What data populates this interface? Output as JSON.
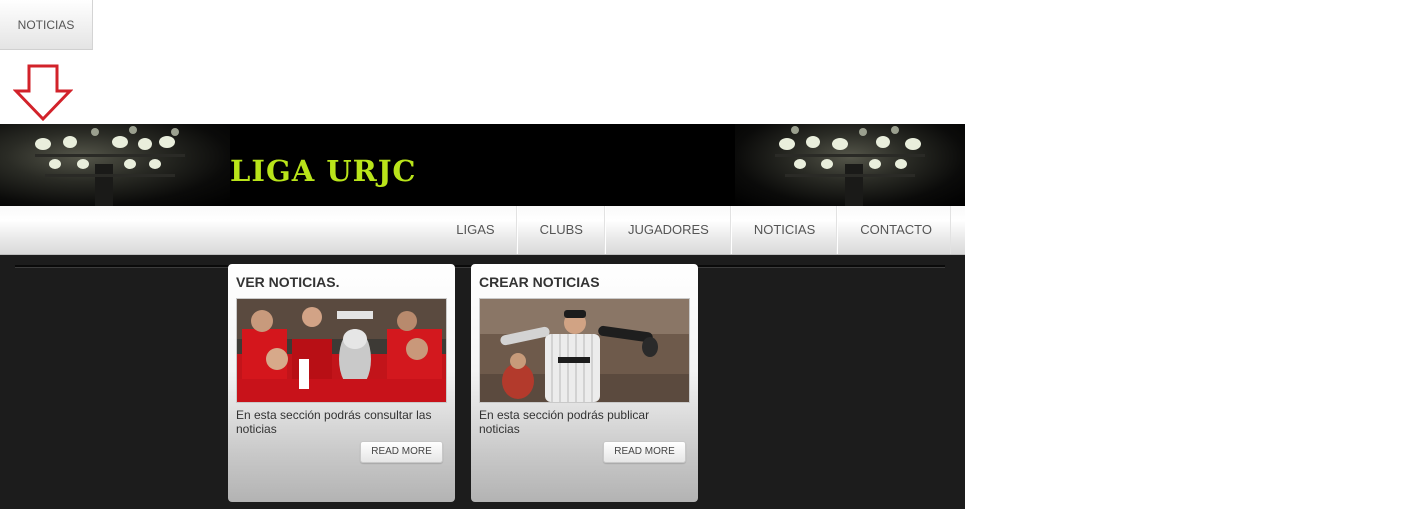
{
  "top_tab": {
    "label": "NOTICIAS"
  },
  "arrow": {
    "color": "#d2222a",
    "icon": "arrow-down-outline"
  },
  "site": {
    "logo_text": "LIGA URJC",
    "logo_color": "#b9e41a",
    "nav": {
      "items": [
        {
          "label": "LIGAS"
        },
        {
          "label": "CLUBS"
        },
        {
          "label": "JUGADORES"
        },
        {
          "label": "NOTICIAS"
        },
        {
          "label": "CONTACTO"
        }
      ]
    },
    "cards": [
      {
        "title": "VER NOTICIAS.",
        "photo": "football-team-trophy-photo",
        "description": "En esta sección podrás consultar las noticias",
        "button": "READ MORE"
      },
      {
        "title": "CREAR NOTICIAS",
        "photo": "baseball-pitcher-photo",
        "description": "En esta sección podrás publicar noticias",
        "button": "READ MORE"
      }
    ]
  }
}
